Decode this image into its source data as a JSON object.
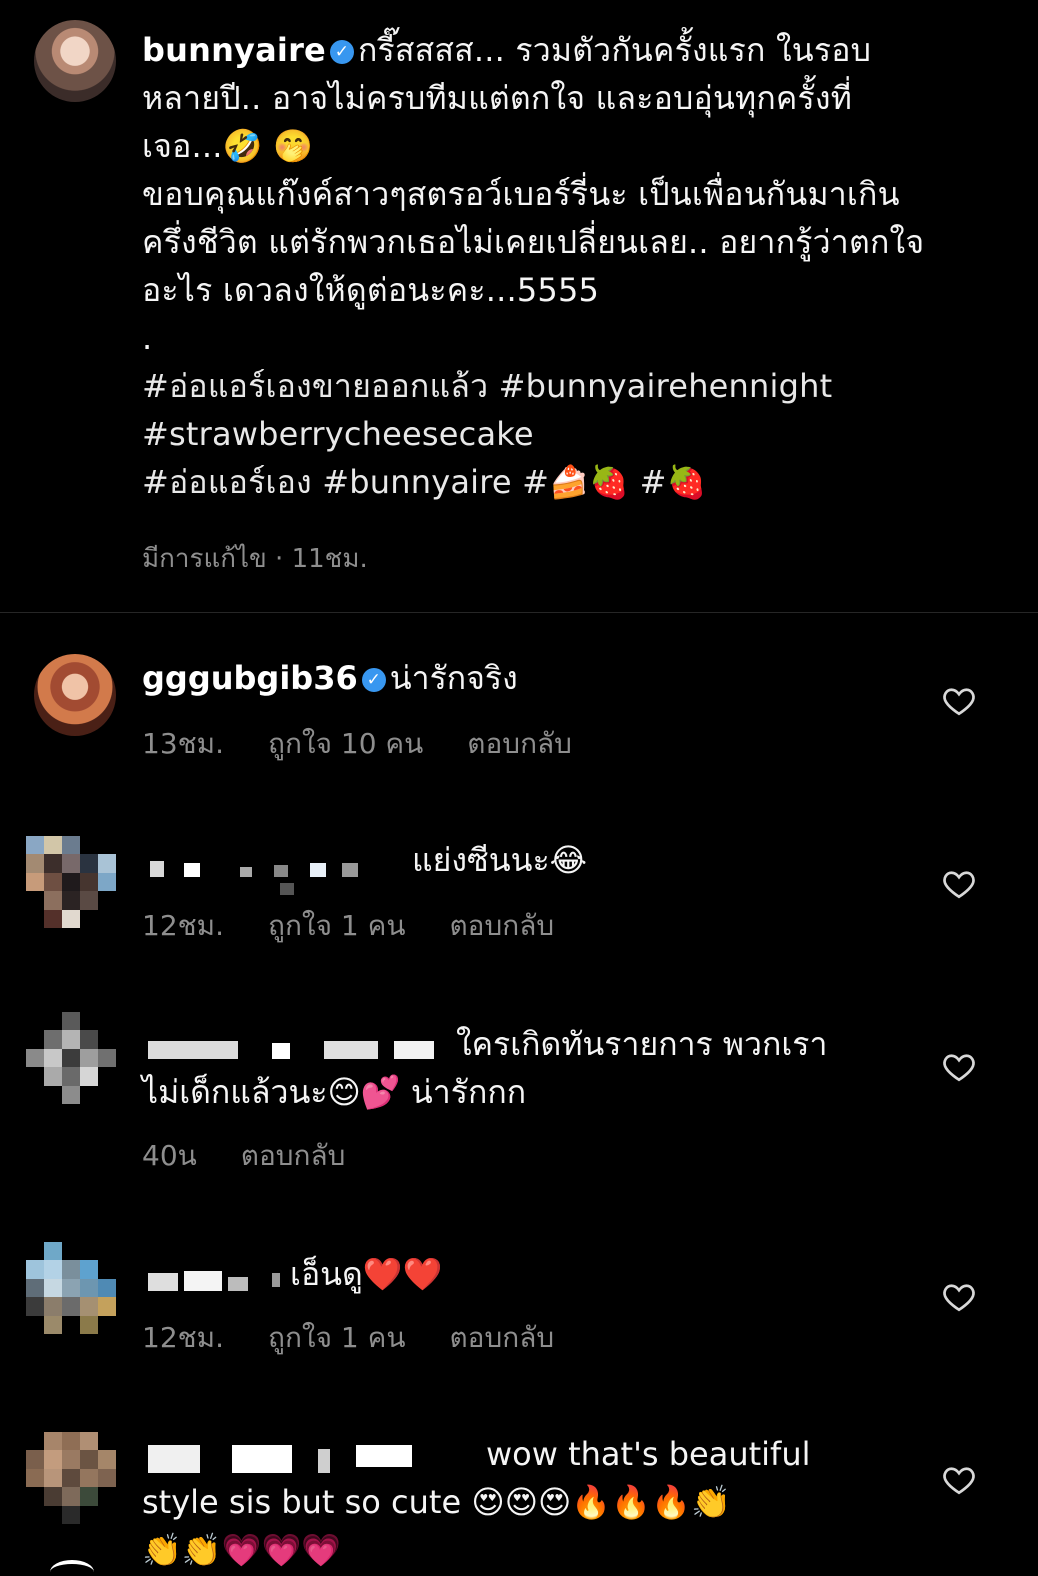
{
  "caption": {
    "username": "bunnyaire",
    "verified_mark": "✓",
    "lines": [
      "กรี๊สสสส... รวมตัวกันครั้งแรก ในรอบ",
      "หลายปี.. อาจไม่ครบทีมแต่ตกใจ และอบอุ่นทุกครั้งที่",
      "เจอ...🤣 🤭",
      "ขอบคุณแก๊งค์สาวๆสตรอว์เบอร์รี่นะ เป็นเพื่อนกันมาเกิน",
      "ครึ่งชีวิต แต่รักพวกเธอไม่เคยเปลี่ยนเลย.. อยากรู้ว่าตกใจ",
      "อะไร เดวลงให้ดูต่อนะคะ...5555",
      "."
    ],
    "hashtags": [
      "#อ่อแอร์เองขายออกแล้ว #bunnyairehennight",
      "#strawberrycheesecake",
      "#อ่อแอร์เอง #bunnyaire #🍰🍓 #🍓"
    ],
    "meta": "มีการแก้ไข · 11ชม."
  },
  "comments": [
    {
      "username": "gggubgib36",
      "verified": true,
      "text": "น่ารักจริง",
      "time": "13ชม.",
      "likes": "ถูกใจ 10 คน",
      "reply": "ตอบกลับ"
    },
    {
      "text": "แย่งซีนนะ😂",
      "time": "12ชม.",
      "likes": "ถูกใจ 1 คน",
      "reply": "ตอบกลับ"
    },
    {
      "text_line1": "ใครเกิดทันรายการ พวกเรา",
      "text_line2": "ไม่เด็กแล้วนะ😊💕 น่ารักกก",
      "time": "40น",
      "reply": "ตอบกลับ"
    },
    {
      "text": "เอ็นดู❤️❤️",
      "time": "12ชม.",
      "likes": "ถูกใจ 1 คน",
      "reply": "ตอบกลับ"
    },
    {
      "text_line1": "wow that's beautiful",
      "text_line2": "style sis but so cute 😍😍😍🔥🔥🔥👏",
      "text_line3": "👏👏💗💗💗"
    }
  ],
  "icons": {
    "heart": "heart-outline-icon",
    "verified": "verified-badge-icon"
  },
  "colors": {
    "background": "#000000",
    "text": "#f5f5f5",
    "muted": "#8e8e8e",
    "verified": "#3897f0"
  }
}
